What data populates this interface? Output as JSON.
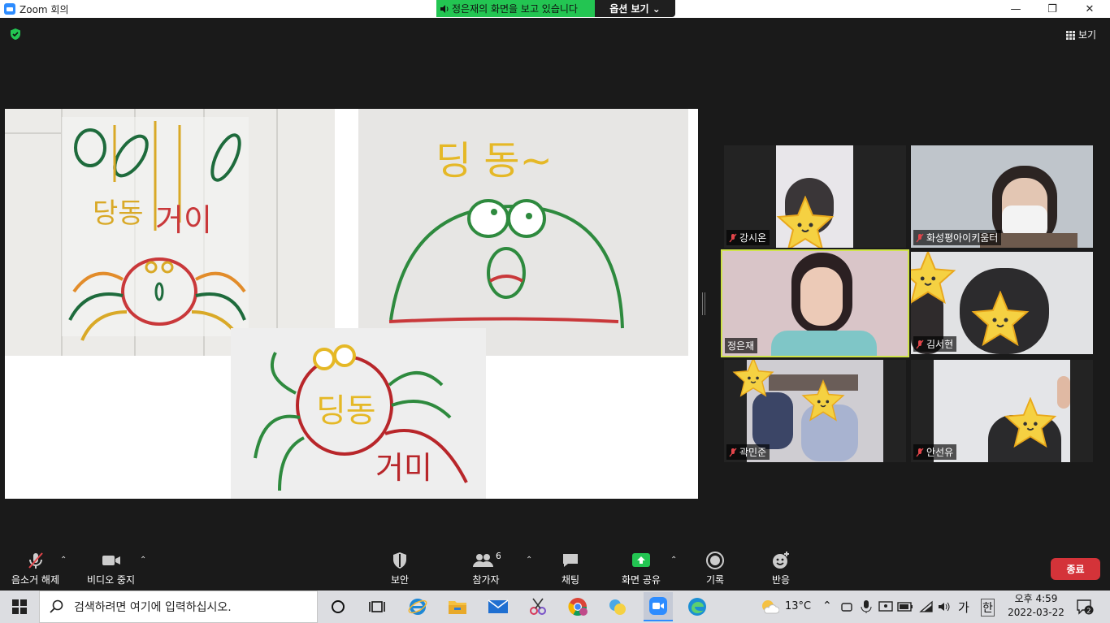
{
  "window": {
    "title": "Zoom 회의",
    "minimize": "—",
    "maximize": "❐",
    "close": "✕"
  },
  "share": {
    "banner": "정은재의 화면을 보고 있습니다",
    "view_options": "옵션 보기 ⌄"
  },
  "view_button": "보기",
  "participants": [
    {
      "name": "강시온",
      "muted": true
    },
    {
      "name": "화성평아이키움터",
      "muted": true
    },
    {
      "name": "정은재",
      "muted": false,
      "active": true
    },
    {
      "name": "김서현",
      "muted": true
    },
    {
      "name": "곽민준",
      "muted": true
    },
    {
      "name": "안선유",
      "muted": true
    }
  ],
  "toolbar": {
    "unmute": "음소거 해제",
    "stop_video": "비디오 중지",
    "security": "보안",
    "participants": "참가자",
    "participant_count": "6",
    "chat": "채팅",
    "share_screen": "화면 공유",
    "record": "기록",
    "reactions": "반응",
    "end": "종료"
  },
  "taskbar": {
    "search_placeholder": "검색하려면 여기에 입력하십시오.",
    "weather": "13°C",
    "ime": "가",
    "ime_mode": "한",
    "time": "오후 4:59",
    "date": "2022-03-22",
    "notifications": "2"
  },
  "colors": {
    "share_green": "#23c552",
    "end_red": "#d43339",
    "active_speaker": "#cfe34a"
  }
}
